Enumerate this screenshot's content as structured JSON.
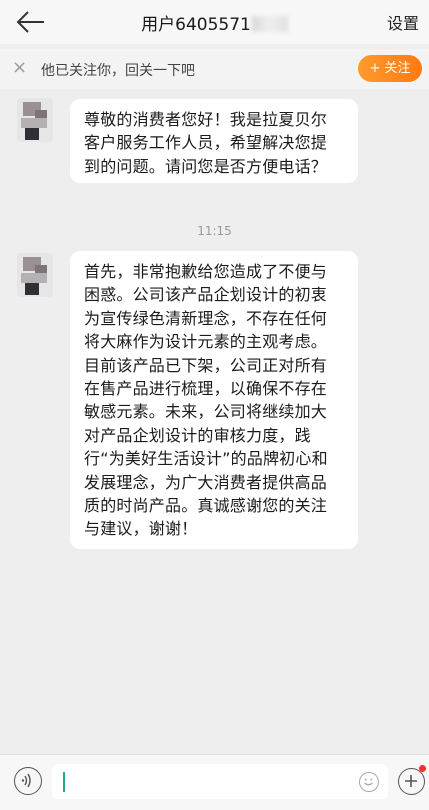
{
  "header": {
    "title_visible": "用户6405571",
    "settings_label": "设置"
  },
  "follow_bar": {
    "hint": "他已关注你，回关一下吧",
    "follow_button": "+ 关注"
  },
  "messages": [
    {
      "lines": [
        "尊敬的消费者您好！我是拉夏贝尔",
        "客户服务工作人员，希望解决您提",
        "到的问题。请问您是否方便电话？"
      ]
    },
    {
      "timestamp": "11:15",
      "lines": [
        "首先，非常抱歉给您造成了不便与",
        "困惑。公司该产品企划设计的初衷",
        "为宣传绿色清新理念，不存在任何",
        "将大麻作为设计元素的主观考虑。",
        "目前该产品已下架，公司正对所有",
        "在售产品进行梳理，以确保不存在",
        "敏感元素。未来，公司将继续加大",
        "对产品企划设计的审核力度，践",
        "行“为美好生活设计”的品牌初心和",
        "发展理念，为广大消费者提供高品",
        "质的时尚产品。真诚感谢您的关注",
        "与建议，谢谢！"
      ]
    }
  ],
  "input": {
    "placeholder": "",
    "value": ""
  },
  "colors": {
    "accent": "#ff8a1f",
    "caret": "#1aad8c",
    "badge": "#ff2d2d"
  },
  "icons": [
    "back-arrow-icon",
    "close-icon",
    "voice-icon",
    "emoji-icon",
    "plus-icon"
  ]
}
